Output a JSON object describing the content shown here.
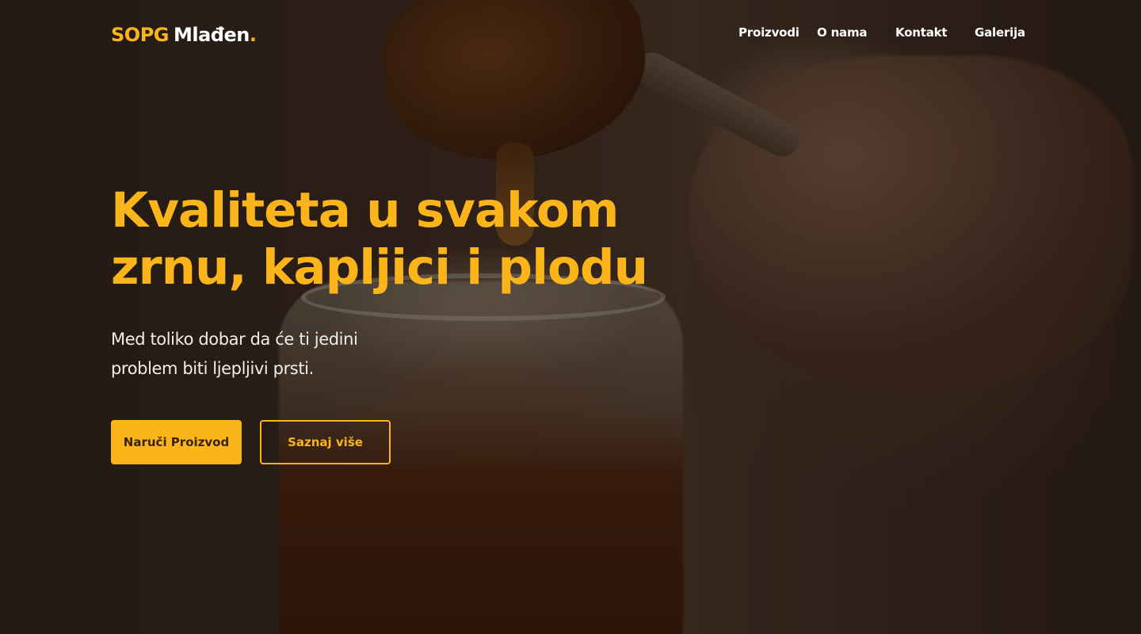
{
  "brand": {
    "accent": "SOPG",
    "name": "Mlađen",
    "dot": ".",
    "accent_color": "#fbb41a"
  },
  "nav": {
    "items": [
      {
        "label": "Proizvodi"
      },
      {
        "label": "O nama"
      },
      {
        "label": "Kontakt"
      },
      {
        "label": "Galerija"
      }
    ]
  },
  "hero": {
    "headline_line1": "Kvaliteta u svakom",
    "headline_line2": "zrnu, kapljici i plodu",
    "subline_line1": "Med toliko dobar da će ti jedini",
    "subline_line2": "problem biti ljepljivi prsti.",
    "primary_button": "Naruči Proizvod",
    "secondary_button": "Saznaj više",
    "background_image": "honey-dipper-over-jar-photo"
  }
}
